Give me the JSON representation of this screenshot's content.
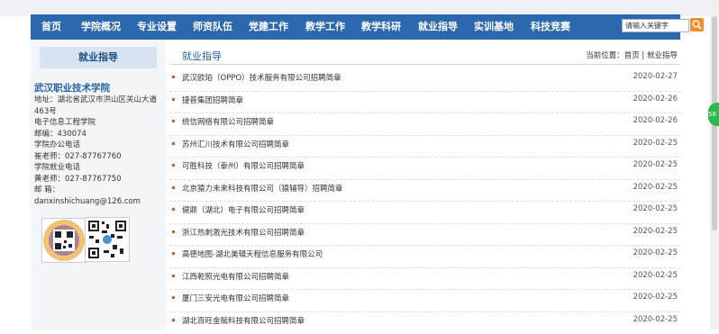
{
  "nav": {
    "items": [
      "首页",
      "学院概况",
      "专业设置",
      "师资队伍",
      "党建工作",
      "教学工作",
      "教学科研",
      "就业指导",
      "实训基地",
      "科技竞赛"
    ],
    "search_placeholder": "请输入关键字"
  },
  "sidebar": {
    "title": "就业指导",
    "org_name": "武汉职业技术学院",
    "lines": [
      "地址：湖北省武汉市洪山区关山大道",
      "463号",
      "电子信息工程学院",
      "邮编：430074",
      "学院办公电话",
      "崔老师：027-87767760",
      "学院就业电话",
      "黄老师：027-87767750",
      "邮  箱：danxinshichuang@126.com"
    ]
  },
  "main": {
    "title": "就业指导",
    "breadcrumb": "当前位置：首页 | 就业指导",
    "articles": [
      {
        "title": "武汉欧珀（OPPO）技术服务有限公司招聘简章",
        "date": "2020-02-27"
      },
      {
        "title": "捷普集团招聘简章",
        "date": "2020-02-26"
      },
      {
        "title": "统信网络有限公司招聘简章",
        "date": "2020-02-26"
      },
      {
        "title": "苏州汇川技术有限公司招聘简章",
        "date": "2020-02-25"
      },
      {
        "title": "可胜科技（泰州）有限公司招聘简章",
        "date": "2020-02-25"
      },
      {
        "title": "北京猿力未来科技有限公司（猿辅导）招聘简章",
        "date": "2020-02-25"
      },
      {
        "title": "健鼎（湖北）电子有限公司招聘简章",
        "date": "2020-02-25"
      },
      {
        "title": "浙江热刺激光技术有限公司招聘简章",
        "date": "2020-02-25"
      },
      {
        "title": "高德地图-湖北美辑天程信息服务有限公司",
        "date": "2020-02-25"
      },
      {
        "title": "江西乾照光电有限公司招聘简章",
        "date": "2020-02-25"
      },
      {
        "title": "厦门三安光电有限公司招聘简章",
        "date": "2020-02-25"
      },
      {
        "title": "湖北百旺金赋科技有限公司招聘简章",
        "date": "2020-02-25"
      }
    ]
  },
  "float_badge": "56"
}
